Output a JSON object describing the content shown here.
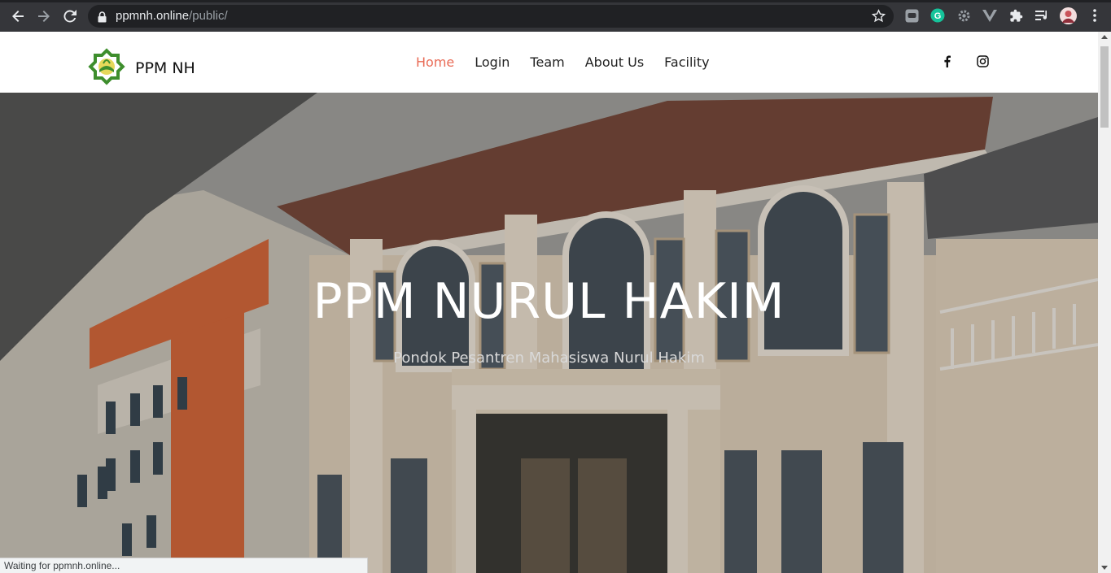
{
  "browser": {
    "url_host": "ppmnh.online",
    "url_path": "/public/",
    "icons": [
      "back-icon",
      "forward-icon",
      "reload-icon",
      "lock-icon",
      "bookmark-star-icon"
    ],
    "extensions": [
      "line-extension-icon",
      "grammarly-extension-icon",
      "settings-extension-icon",
      "vue-devtools-icon",
      "extensions-puzzle-icon",
      "reading-list-icon",
      "profile-avatar",
      "kebab-menu-icon"
    ]
  },
  "site": {
    "brand": "PPM NH",
    "menu": {
      "home": "Home",
      "login": "Login",
      "team": "Team",
      "about": "About Us",
      "facility": "Facility"
    },
    "social": [
      "facebook-icon",
      "instagram-icon"
    ],
    "accent_color": "#e96b56"
  },
  "hero": {
    "title": "PPM NURUL HAKIM",
    "subtitle": "Pondok Pesantren Mahasiswa Nurul Hakim"
  },
  "status": {
    "text": "Waiting for ppmnh.online..."
  }
}
